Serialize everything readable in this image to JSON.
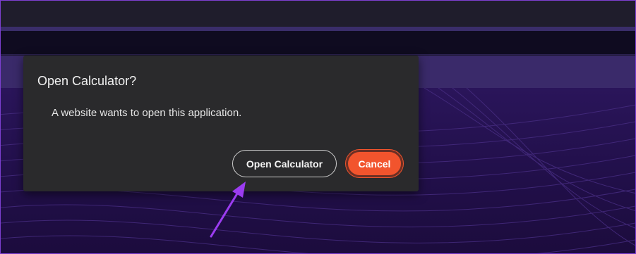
{
  "dialog": {
    "title": "Open Calculator?",
    "message": "A website wants to open this application.",
    "open_button_label": "Open Calculator",
    "cancel_button_label": "Cancel"
  },
  "colors": {
    "accent": "#f2542d",
    "annotation_arrow": "#9b3cf0",
    "frame_border": "#7d3fd1",
    "dialog_background": "#2a2a2c"
  },
  "icons": {
    "annotation": "arrow-icon"
  }
}
